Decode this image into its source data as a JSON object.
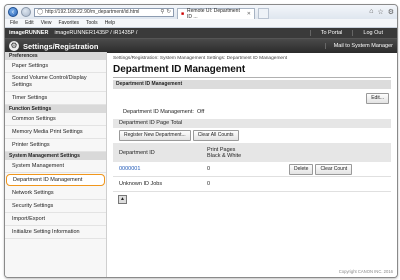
{
  "browser": {
    "url": "http://192.168.22.90/m_department/id.html",
    "tab_title": "Remote UI: Department ID ...",
    "menu": [
      "File",
      "Edit",
      "View",
      "Favorites",
      "Tools",
      "Help"
    ]
  },
  "header": {
    "product": "imageRUNNER",
    "device": "imageRUNNER1435P / iR1435P /",
    "to_portal": "To Portal",
    "log_out": "Log Out",
    "section_title": "Settings/Registration",
    "mail": "Mail to System Manager"
  },
  "sidebar": {
    "groups": [
      {
        "heading": "Preferences",
        "items": [
          "Paper Settings",
          "Sound Volume Control/Display Settings",
          "Timer Settings"
        ]
      },
      {
        "heading": "Function Settings",
        "items": [
          "Common Settings",
          "Memory Media Print Settings",
          "Printer Settings"
        ]
      },
      {
        "heading": "System Management Settings",
        "items": [
          "System Management",
          "Department ID Management",
          "Network Settings",
          "Security Settings",
          "Import/Export",
          "Initialize Setting Information"
        ]
      }
    ]
  },
  "main": {
    "breadcrumb": "Settings/Registration: System Management Settings: Department ID Management",
    "title": "Department ID Management",
    "section": "Department ID Management",
    "edit_button": "Edit...",
    "mgmt_label": "Department ID Management:",
    "mgmt_value": "Off",
    "page_total_label": "Department ID Page Total",
    "register_button": "Register New Department...",
    "clear_all_button": "Clear All Counts",
    "table": {
      "col_id": "Department ID",
      "col_pages_1": "Print Pages",
      "col_pages_2": "Black & White",
      "rows": [
        {
          "id": "0000001",
          "pages": "0",
          "delete": "Delete",
          "clear": "Clear Count"
        },
        {
          "id": "Unknown ID Jobs",
          "pages": "0"
        }
      ]
    },
    "copyright": "Copyright CANON INC. 2016"
  }
}
